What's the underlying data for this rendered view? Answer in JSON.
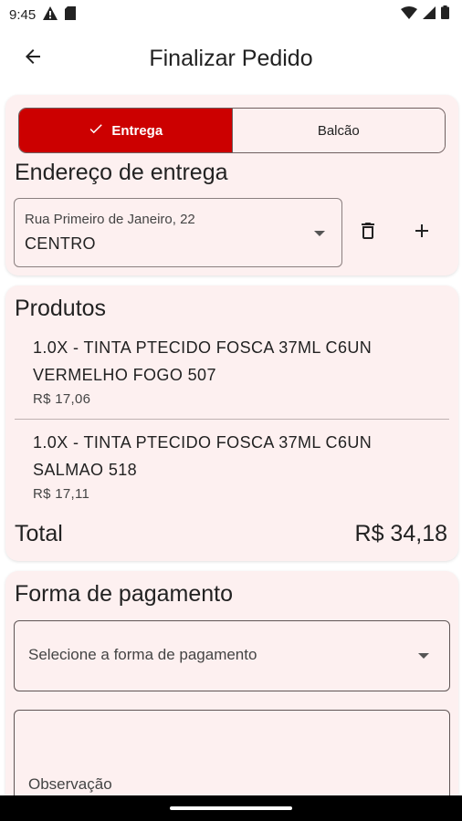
{
  "status": {
    "time": "9:45"
  },
  "appbar": {
    "title": "Finalizar Pedido"
  },
  "delivery": {
    "options": [
      {
        "label": "Entrega",
        "selected": true
      },
      {
        "label": "Balcão",
        "selected": false
      }
    ]
  },
  "address": {
    "section_title": "Endereço de entrega",
    "street": "Rua Primeiro de Janeiro, 22",
    "district": "CENTRO"
  },
  "products": {
    "section_title": "Produtos",
    "items": [
      {
        "line1": "1.0X - TINTA PTECIDO FOSCA 37ML C6UN",
        "line2": "VERMELHO FOGO 507",
        "price": "R$ 17,06"
      },
      {
        "line1": "1.0X - TINTA PTECIDO FOSCA 37ML C6UN",
        "line2": "SALMAO 518",
        "price": "R$ 17,11"
      }
    ],
    "total_label": "Total",
    "total_value": "R$ 34,18"
  },
  "payment": {
    "section_title": "Forma de pagamento",
    "placeholder": "Selecione a forma de pagamento",
    "observation_label": "Observação"
  },
  "colors": {
    "accent": "#cc0000",
    "card_background": "#fdf0f0"
  }
}
